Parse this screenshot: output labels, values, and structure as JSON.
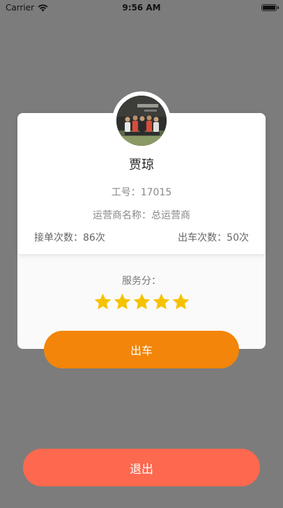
{
  "status_bar": {
    "carrier": "Carrier",
    "time": "9:56 AM",
    "icons": [
      "wifi-icon",
      "battery-icon"
    ]
  },
  "profile": {
    "name": "贾琼",
    "employee_id": "工号：17015",
    "operator": "运营商名称：总运营商",
    "orders_count": "接单次数：86次",
    "trips_count": "出车次数：50次",
    "score_label": "服务分：",
    "rating": 5,
    "rating_max": 5,
    "star_color": "#f5c200"
  },
  "actions": {
    "depart_label": "出车",
    "logout_label": "退出"
  },
  "colors": {
    "background": "#7c7c7c",
    "depart_button": "#f2850a",
    "logout_button": "#fc694f"
  }
}
